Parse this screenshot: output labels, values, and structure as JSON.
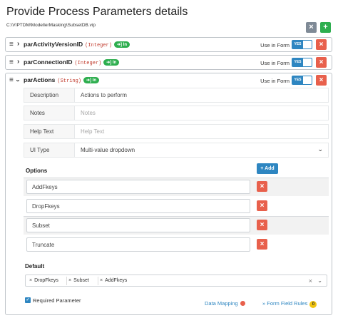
{
  "header": {
    "title": "Provide Process Parameters details",
    "path": "C:\\VIPTDM\\ModellerMasking\\SubsetDB.vip",
    "close_icon": "×",
    "add_icon": "+"
  },
  "parameters": [
    {
      "name": "parActivityVersionID",
      "type": "(Integer)",
      "direction": "In",
      "use_in_form_label": "Use in Form",
      "toggle": "YES"
    },
    {
      "name": "parConnectionID",
      "type": "(Integer)",
      "direction": "In",
      "use_in_form_label": "Use in Form",
      "toggle": "YES"
    },
    {
      "name": "parActions",
      "type": "(String)",
      "direction": "In",
      "use_in_form_label": "Use in Form",
      "toggle": "YES"
    }
  ],
  "details": {
    "description": {
      "label": "Description",
      "value": "Actions to perform"
    },
    "notes": {
      "label": "Notes",
      "placeholder": "Notes"
    },
    "help_text": {
      "label": "Help Text",
      "placeholder": "Help Text"
    },
    "ui_type": {
      "label": "UI Type",
      "value": "Multi-value dropdown"
    }
  },
  "options": {
    "label": "Options",
    "add_label": "+ Add",
    "items": [
      "AddFkeys",
      "DropFkeys",
      "Subset",
      "Truncate"
    ]
  },
  "default": {
    "label": "Default",
    "selected": [
      "DropFkeys",
      "Subset",
      "AddFkeys"
    ]
  },
  "footer": {
    "required_label": "Required Parameter",
    "required_checked": true,
    "data_mapping_label": "Data Mapping",
    "form_field_rules_label": "» Form Field Rules",
    "form_field_rules_count": "0"
  },
  "colors": {
    "accent_blue": "#2e86c1",
    "green": "#2eae4f",
    "red": "#e8604c",
    "gray_button": "#7f8a96",
    "yellow_badge": "#f1c40f"
  }
}
